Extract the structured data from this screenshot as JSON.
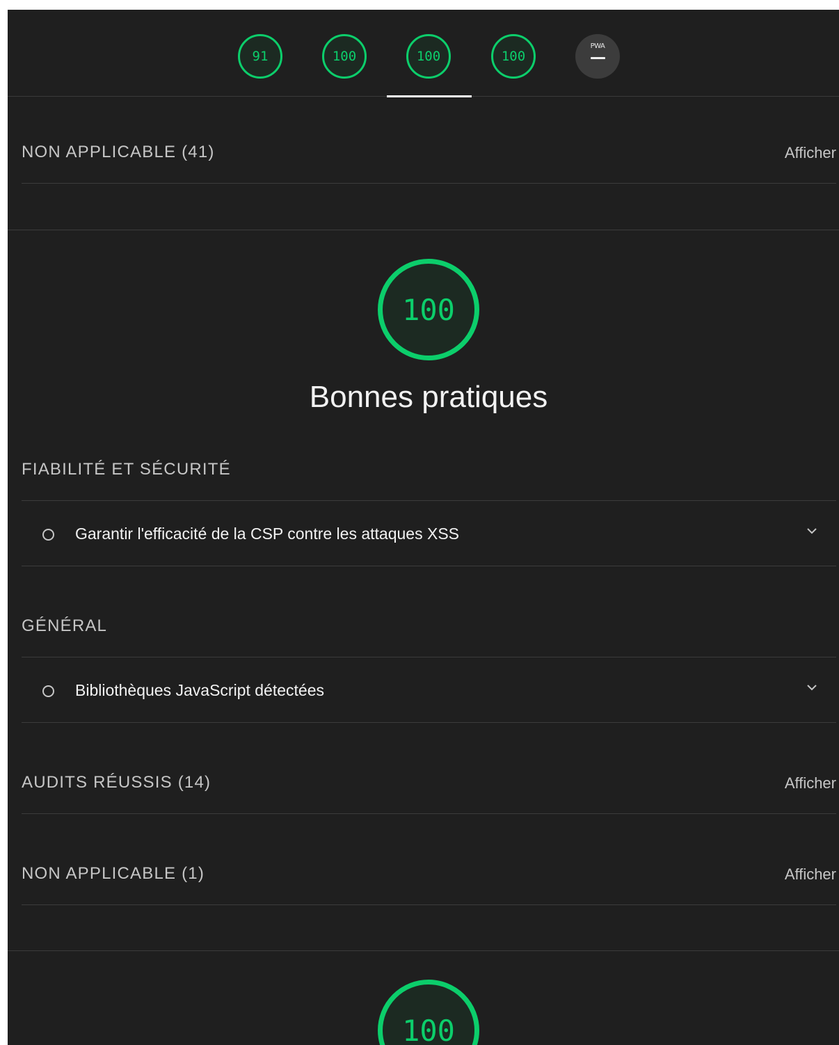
{
  "nav": {
    "scores": [
      "91",
      "100",
      "100",
      "100"
    ],
    "pwa_label": "PWA"
  },
  "sections": {
    "non_applicable_top": {
      "title": "NON APPLICABLE (41)",
      "action": "Afficher"
    },
    "category": {
      "score": "100",
      "title": "Bonnes pratiques"
    },
    "reliability": {
      "title": "FIABILITÉ ET SÉCURITÉ"
    },
    "audit_csp": {
      "label": "Garantir l'efficacité de la CSP contre les attaques XSS"
    },
    "general": {
      "title": "GÉNÉRAL"
    },
    "audit_js": {
      "label": "Bibliothèques JavaScript détectées"
    },
    "passed": {
      "title": "AUDITS RÉUSSIS (14)",
      "action": "Afficher"
    },
    "non_applicable_bottom": {
      "title": "NON APPLICABLE (1)",
      "action": "Afficher"
    },
    "next_category": {
      "score": "100"
    }
  },
  "colors": {
    "pass": "#0cce6b",
    "background": "#1f1f1f"
  }
}
